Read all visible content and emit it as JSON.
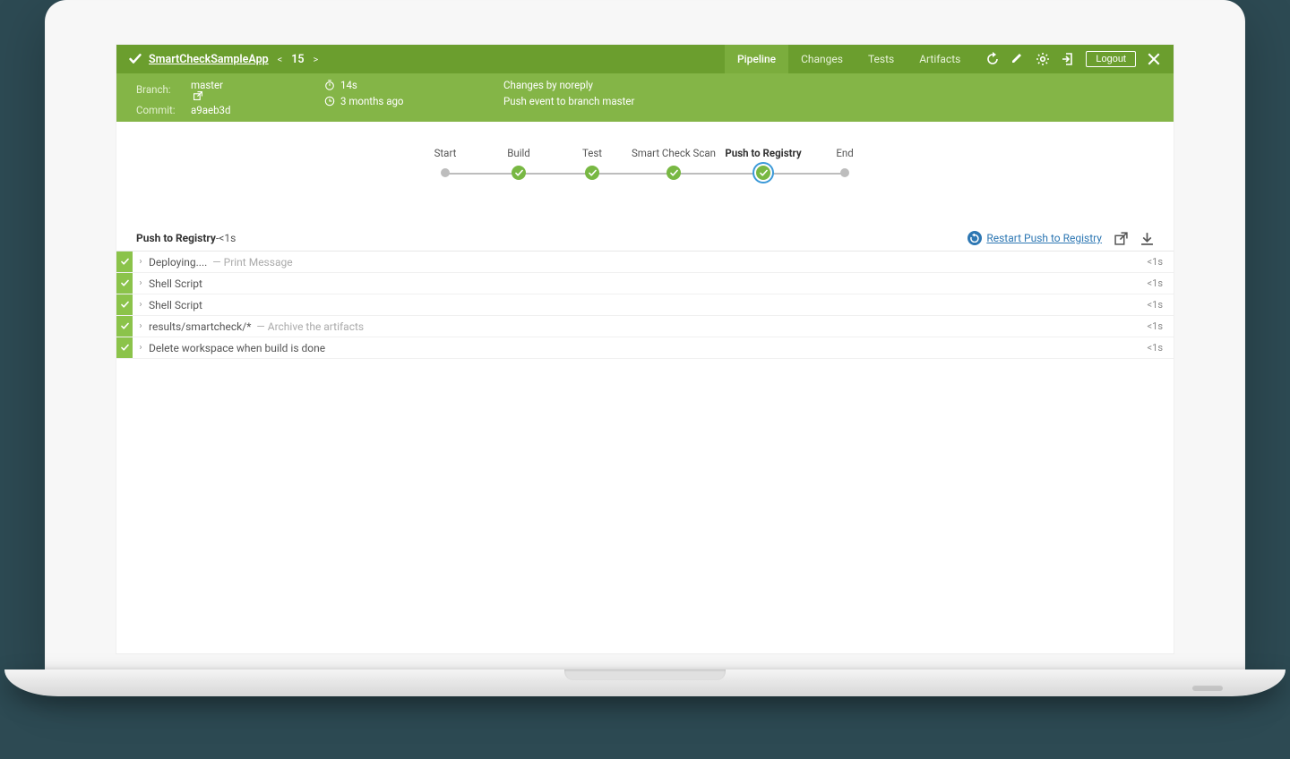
{
  "header": {
    "title": "SmartCheckSampleApp",
    "run_number": "15",
    "tabs": [
      {
        "label": "Pipeline",
        "active": true
      },
      {
        "label": "Changes",
        "active": false
      },
      {
        "label": "Tests",
        "active": false
      },
      {
        "label": "Artifacts",
        "active": false
      }
    ],
    "logout": "Logout"
  },
  "subheader": {
    "branch_label": "Branch:",
    "branch_value": "master",
    "commit_label": "Commit:",
    "commit_value": "a9aeb3d",
    "duration": "14s",
    "age": "3 months ago",
    "changes": "Changes by noreply",
    "event": "Push event to branch master"
  },
  "pipeline": {
    "stages": [
      {
        "label": "Start",
        "type": "dot"
      },
      {
        "label": "Build",
        "type": "pass"
      },
      {
        "label": "Test",
        "type": "pass"
      },
      {
        "label": "Smart Check Scan",
        "type": "pass",
        "wide": true
      },
      {
        "label": "Push to Registry",
        "type": "pass",
        "wide": true,
        "selected": true
      },
      {
        "label": "End",
        "type": "dot"
      }
    ]
  },
  "stage_detail": {
    "title": "Push to Registry",
    "dash": " - ",
    "duration": "<1s",
    "restart_label": "Restart Push to Registry",
    "steps": [
      {
        "name": "Deploying....",
        "desc": "Print Message",
        "duration": "<1s"
      },
      {
        "name": "Shell Script",
        "desc": "",
        "duration": "<1s"
      },
      {
        "name": "Shell Script",
        "desc": "",
        "duration": "<1s"
      },
      {
        "name": "results/smartcheck/*",
        "desc": "Archive the artifacts",
        "duration": "<1s"
      },
      {
        "name": "Delete workspace when build is done",
        "desc": "",
        "duration": "<1s"
      }
    ]
  }
}
